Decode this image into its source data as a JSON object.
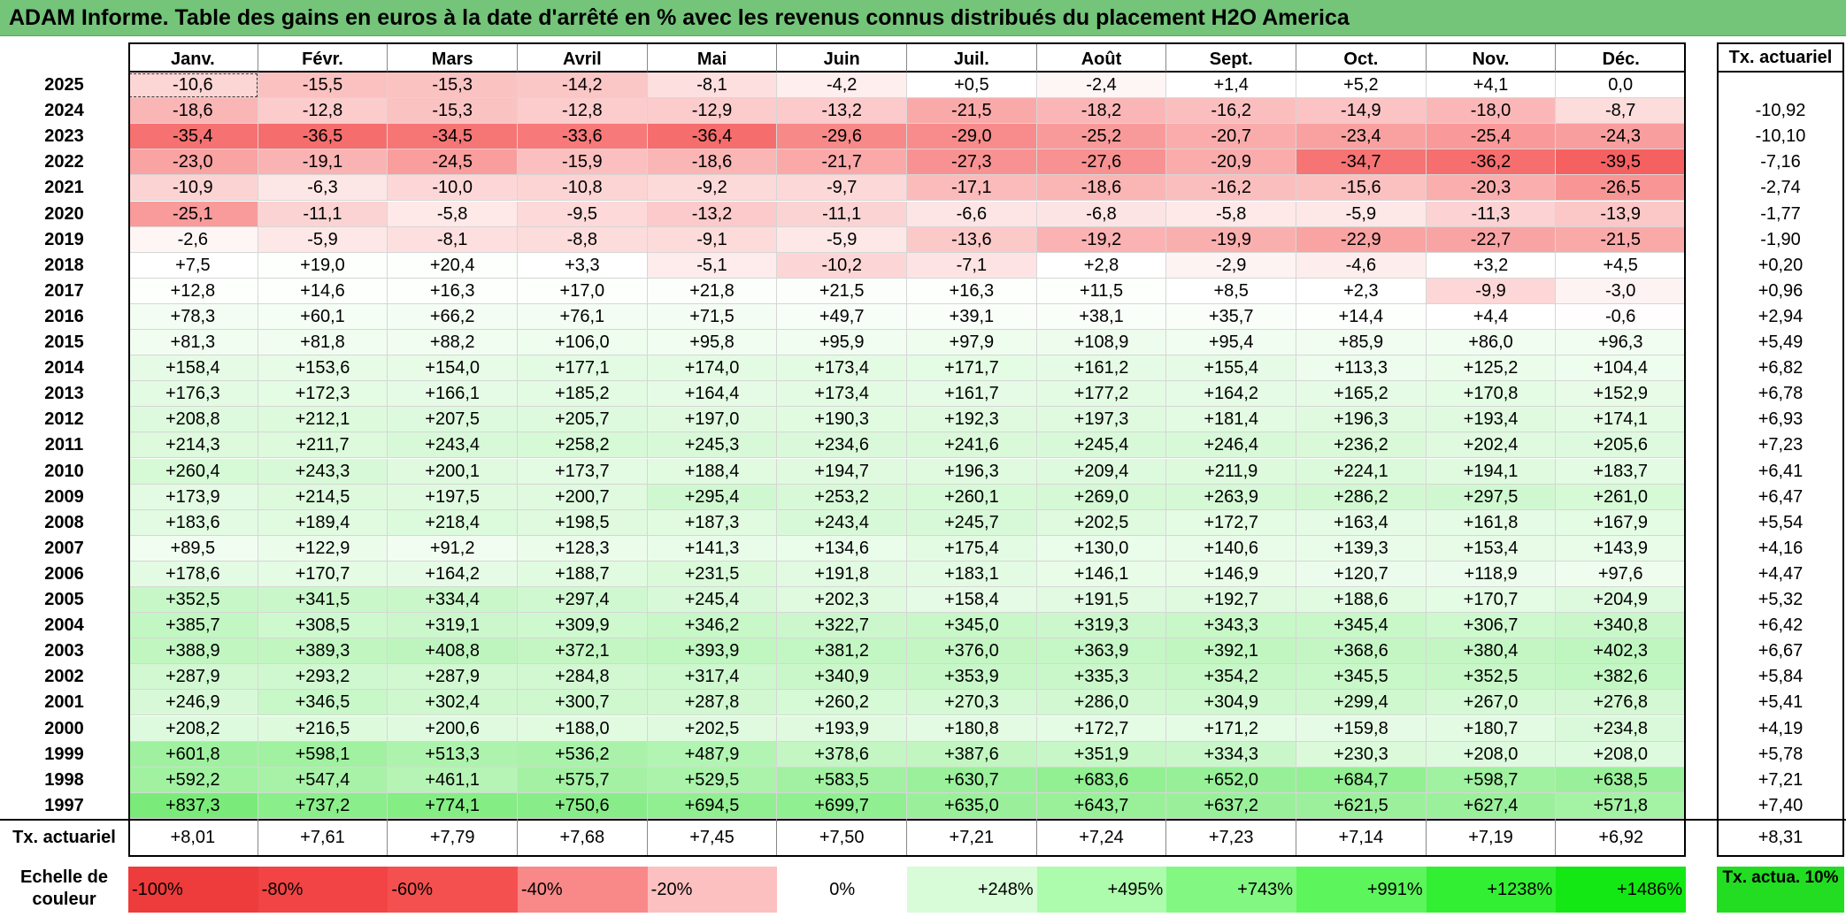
{
  "title": "ADAM Informe. Table des gains en euros à la date d'arrêté en % avec les revenus connus distribués du placement H2O America",
  "months": [
    "Janv.",
    "Févr.",
    "Mars",
    "Avril",
    "Mai",
    "Juin",
    "Juil.",
    "Août",
    "Sept.",
    "Oct.",
    "Nov.",
    "Déc."
  ],
  "actuarial_header": "Tx. actuariel",
  "rows": [
    {
      "year": "2025",
      "values": [
        "-10,6",
        "-15,5",
        "-15,3",
        "-14,2",
        "-8,1",
        "-4,2",
        "+0,5",
        "-2,4",
        "+1,4",
        "+5,2",
        "+4,1",
        "0,0"
      ],
      "rate": ""
    },
    {
      "year": "2024",
      "values": [
        "-18,6",
        "-12,8",
        "-15,3",
        "-12,8",
        "-12,9",
        "-13,2",
        "-21,5",
        "-18,2",
        "-16,2",
        "-14,9",
        "-18,0",
        "-8,7"
      ],
      "rate": "-10,92"
    },
    {
      "year": "2023",
      "values": [
        "-35,4",
        "-36,5",
        "-34,5",
        "-33,6",
        "-36,4",
        "-29,6",
        "-29,0",
        "-25,2",
        "-20,7",
        "-23,4",
        "-25,4",
        "-24,3"
      ],
      "rate": "-10,10"
    },
    {
      "year": "2022",
      "values": [
        "-23,0",
        "-19,1",
        "-24,5",
        "-15,9",
        "-18,6",
        "-21,7",
        "-27,3",
        "-27,6",
        "-20,9",
        "-34,7",
        "-36,2",
        "-39,5"
      ],
      "rate": "-7,16"
    },
    {
      "year": "2021",
      "values": [
        "-10,9",
        "-6,3",
        "-10,0",
        "-10,8",
        "-9,2",
        "-9,7",
        "-17,1",
        "-18,6",
        "-16,2",
        "-15,6",
        "-20,3",
        "-26,5"
      ],
      "rate": "-2,74"
    },
    {
      "year": "2020",
      "values": [
        "-25,1",
        "-11,1",
        "-5,8",
        "-9,5",
        "-13,2",
        "-11,1",
        "-6,6",
        "-6,8",
        "-5,8",
        "-5,9",
        "-11,3",
        "-13,9"
      ],
      "rate": "-1,77"
    },
    {
      "year": "2019",
      "values": [
        "-2,6",
        "-5,9",
        "-8,1",
        "-8,8",
        "-9,1",
        "-5,9",
        "-13,6",
        "-19,2",
        "-19,9",
        "-22,9",
        "-22,7",
        "-21,5"
      ],
      "rate": "-1,90"
    },
    {
      "year": "2018",
      "values": [
        "+7,5",
        "+19,0",
        "+20,4",
        "+3,3",
        "-5,1",
        "-10,2",
        "-7,1",
        "+2,8",
        "-2,9",
        "-4,6",
        "+3,2",
        "+4,5"
      ],
      "rate": "+0,20"
    },
    {
      "year": "2017",
      "values": [
        "+12,8",
        "+14,6",
        "+16,3",
        "+17,0",
        "+21,8",
        "+21,5",
        "+16,3",
        "+11,5",
        "+8,5",
        "+2,3",
        "-9,9",
        "-3,0"
      ],
      "rate": "+0,96"
    },
    {
      "year": "2016",
      "values": [
        "+78,3",
        "+60,1",
        "+66,2",
        "+76,1",
        "+71,5",
        "+49,7",
        "+39,1",
        "+38,1",
        "+35,7",
        "+14,4",
        "+4,4",
        "-0,6"
      ],
      "rate": "+2,94"
    },
    {
      "year": "2015",
      "values": [
        "+81,3",
        "+81,8",
        "+88,2",
        "+106,0",
        "+95,8",
        "+95,9",
        "+97,9",
        "+108,9",
        "+95,4",
        "+85,9",
        "+86,0",
        "+96,3"
      ],
      "rate": "+5,49"
    },
    {
      "year": "2014",
      "values": [
        "+158,4",
        "+153,6",
        "+154,0",
        "+177,1",
        "+174,0",
        "+173,4",
        "+171,7",
        "+161,2",
        "+155,4",
        "+113,3",
        "+125,2",
        "+104,4"
      ],
      "rate": "+6,82"
    },
    {
      "year": "2013",
      "values": [
        "+176,3",
        "+172,3",
        "+166,1",
        "+185,2",
        "+164,4",
        "+173,4",
        "+161,7",
        "+177,2",
        "+164,2",
        "+165,2",
        "+170,8",
        "+152,9"
      ],
      "rate": "+6,78"
    },
    {
      "year": "2012",
      "values": [
        "+208,8",
        "+212,1",
        "+207,5",
        "+205,7",
        "+197,0",
        "+190,3",
        "+192,3",
        "+197,3",
        "+181,4",
        "+196,3",
        "+193,4",
        "+174,1"
      ],
      "rate": "+6,93"
    },
    {
      "year": "2011",
      "values": [
        "+214,3",
        "+211,7",
        "+243,4",
        "+258,2",
        "+245,3",
        "+234,6",
        "+241,6",
        "+245,4",
        "+246,4",
        "+236,2",
        "+202,4",
        "+205,6"
      ],
      "rate": "+7,23"
    },
    {
      "year": "2010",
      "values": [
        "+260,4",
        "+243,3",
        "+200,1",
        "+173,7",
        "+188,4",
        "+194,7",
        "+196,3",
        "+209,4",
        "+211,9",
        "+224,1",
        "+194,1",
        "+183,7"
      ],
      "rate": "+6,41"
    },
    {
      "year": "2009",
      "values": [
        "+173,9",
        "+214,5",
        "+197,5",
        "+200,7",
        "+295,4",
        "+253,2",
        "+260,1",
        "+269,0",
        "+263,9",
        "+286,2",
        "+297,5",
        "+261,0"
      ],
      "rate": "+6,47"
    },
    {
      "year": "2008",
      "values": [
        "+183,6",
        "+189,4",
        "+218,4",
        "+198,5",
        "+187,3",
        "+243,4",
        "+245,7",
        "+202,5",
        "+172,7",
        "+163,4",
        "+161,8",
        "+167,9"
      ],
      "rate": "+5,54"
    },
    {
      "year": "2007",
      "values": [
        "+89,5",
        "+122,9",
        "+91,2",
        "+128,3",
        "+141,3",
        "+134,6",
        "+175,4",
        "+130,0",
        "+140,6",
        "+139,3",
        "+153,4",
        "+143,9"
      ],
      "rate": "+4,16"
    },
    {
      "year": "2006",
      "values": [
        "+178,6",
        "+170,7",
        "+164,2",
        "+188,7",
        "+231,5",
        "+191,8",
        "+183,1",
        "+146,1",
        "+146,9",
        "+120,7",
        "+118,9",
        "+97,6"
      ],
      "rate": "+4,47"
    },
    {
      "year": "2005",
      "values": [
        "+352,5",
        "+341,5",
        "+334,4",
        "+297,4",
        "+245,4",
        "+202,3",
        "+158,4",
        "+191,5",
        "+192,7",
        "+188,6",
        "+170,7",
        "+204,9"
      ],
      "rate": "+5,32"
    },
    {
      "year": "2004",
      "values": [
        "+385,7",
        "+308,5",
        "+319,1",
        "+309,9",
        "+346,2",
        "+322,7",
        "+345,0",
        "+319,3",
        "+343,3",
        "+345,4",
        "+306,7",
        "+340,8"
      ],
      "rate": "+6,42"
    },
    {
      "year": "2003",
      "values": [
        "+388,9",
        "+389,3",
        "+408,8",
        "+372,1",
        "+393,9",
        "+381,2",
        "+376,0",
        "+363,9",
        "+392,1",
        "+368,6",
        "+380,4",
        "+402,3"
      ],
      "rate": "+6,67"
    },
    {
      "year": "2002",
      "values": [
        "+287,9",
        "+293,2",
        "+287,9",
        "+284,8",
        "+317,4",
        "+340,9",
        "+353,9",
        "+335,3",
        "+354,2",
        "+345,5",
        "+352,5",
        "+382,6"
      ],
      "rate": "+5,84"
    },
    {
      "year": "2001",
      "values": [
        "+246,9",
        "+346,5",
        "+302,4",
        "+300,7",
        "+287,8",
        "+260,2",
        "+270,3",
        "+286,0",
        "+304,9",
        "+299,4",
        "+267,0",
        "+276,8"
      ],
      "rate": "+5,41"
    },
    {
      "year": "2000",
      "values": [
        "+208,2",
        "+216,5",
        "+200,6",
        "+188,0",
        "+202,5",
        "+193,9",
        "+180,8",
        "+172,7",
        "+171,2",
        "+159,8",
        "+180,7",
        "+234,8"
      ],
      "rate": "+4,19"
    },
    {
      "year": "1999",
      "values": [
        "+601,8",
        "+598,1",
        "+513,3",
        "+536,2",
        "+487,9",
        "+378,6",
        "+387,6",
        "+351,9",
        "+334,3",
        "+230,3",
        "+208,0",
        "+208,0"
      ],
      "rate": "+5,78"
    },
    {
      "year": "1998",
      "values": [
        "+592,2",
        "+547,4",
        "+461,1",
        "+575,7",
        "+529,5",
        "+583,5",
        "+630,7",
        "+683,6",
        "+652,0",
        "+684,7",
        "+598,7",
        "+638,5"
      ],
      "rate": "+7,21"
    },
    {
      "year": "1997",
      "values": [
        "+837,3",
        "+737,2",
        "+774,1",
        "+750,6",
        "+694,5",
        "+699,7",
        "+635,0",
        "+643,7",
        "+637,2",
        "+621,5",
        "+627,4",
        "+571,8"
      ],
      "rate": "+7,40"
    }
  ],
  "footer": {
    "label": "Tx. actuariel",
    "values": [
      "+8,01",
      "+7,61",
      "+7,79",
      "+7,68",
      "+7,45",
      "+7,50",
      "+7,21",
      "+7,24",
      "+7,23",
      "+7,14",
      "+7,19",
      "+6,92"
    ],
    "rate": "+8,31"
  },
  "legend": {
    "label": "Echelle de couleur",
    "items": [
      {
        "text": "-100%",
        "color": "#ee3b3b"
      },
      {
        "text": "-80%",
        "color": "#f24444"
      },
      {
        "text": "-60%",
        "color": "#f55050"
      },
      {
        "text": "-40%",
        "color": "#f98888"
      },
      {
        "text": "-20%",
        "color": "#fcc0c0"
      },
      {
        "text": "0%",
        "color": "#ffffff"
      },
      {
        "text": "+248%",
        "color": "#d7fcd7"
      },
      {
        "text": "+495%",
        "color": "#adfbad"
      },
      {
        "text": "+743%",
        "color": "#82f882"
      },
      {
        "text": "+991%",
        "color": "#5cf55c"
      },
      {
        "text": "+1238%",
        "color": "#33ef33"
      },
      {
        "text": "+1486%",
        "color": "#14e814"
      }
    ],
    "actuarial_label": "Tx. actua. 10%",
    "actuarial_color": "#22dd22"
  },
  "colors": {
    "title_bar": "#74c47a",
    "neg_scale_at_minus_60": "#f55050",
    "pos_scale_at_plus_1486": "#14e814"
  }
}
